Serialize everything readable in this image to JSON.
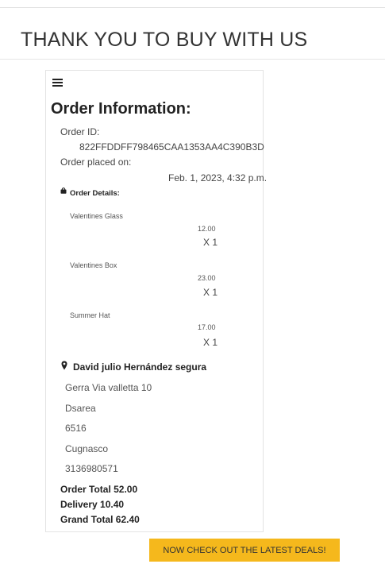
{
  "page": {
    "title": "THANK YOU TO BUY WITH US"
  },
  "order": {
    "heading": "Order Information:",
    "id_label": "Order ID:",
    "id_value": "822FFDDFF798465CAA1353AA4C390B3D",
    "placed_label": "Order placed on:",
    "placed_value": "Feb. 1, 2023, 4:32 p.m.",
    "details_label": "Order Details:",
    "items": [
      {
        "name": "Valentines Glass",
        "price": "12.00",
        "qty": "X 1"
      },
      {
        "name": "Valentines Box",
        "price": "23.00",
        "qty": "X 1"
      },
      {
        "name": "Summer Hat",
        "price": "17.00",
        "qty": "X 1"
      }
    ]
  },
  "shipping": {
    "name": "David julio Hernández segura",
    "address_lines": [
      "Gerra Via valletta 10",
      "Dsarea",
      "6516",
      "Cugnasco",
      "3136980571"
    ]
  },
  "totals": {
    "order_total": "Order Total 52.00",
    "delivery": "Delivery 10.40",
    "grand_total": "Grand Total 62.40"
  },
  "cta": {
    "label": "NOW CHECK OUT THE LATEST DEALS!",
    "color": "#f5b81c"
  },
  "icons": {
    "menu": "menu-icon",
    "bag": "bag-icon",
    "pin": "map-pin-icon"
  }
}
